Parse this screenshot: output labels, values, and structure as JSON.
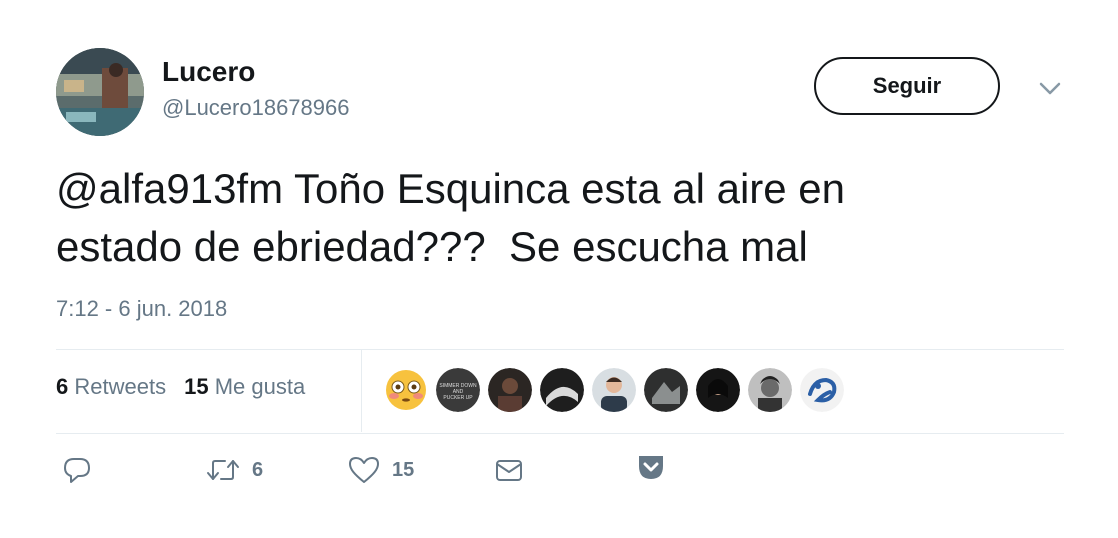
{
  "user": {
    "name": "Lucero",
    "handle": "@Lucero18678966",
    "avatar_icon": "user-avatar-photo"
  },
  "follow_button": {
    "label": "Seguir"
  },
  "menu": {
    "icon": "chevron-down-icon"
  },
  "tweet": {
    "text": "@alfa913fm Toño Esquinca esta al aire en\nestado de ebriedad???  Se escucha mal",
    "timestamp": "7:12 - 6 jun. 2018"
  },
  "stats": {
    "retweets_count": "6",
    "retweets_label": "Retweets",
    "likes_count": "15",
    "likes_label": "Me gusta"
  },
  "likers": [
    {
      "icon": "flushed-emoji-avatar"
    },
    {
      "icon": "liker-avatar-2"
    },
    {
      "icon": "liker-avatar-3"
    },
    {
      "icon": "liker-avatar-4"
    },
    {
      "icon": "liker-avatar-5"
    },
    {
      "icon": "liker-avatar-6"
    },
    {
      "icon": "liker-avatar-7"
    },
    {
      "icon": "liker-avatar-8"
    },
    {
      "icon": "liker-avatar-9"
    }
  ],
  "liker2_text": "SIMMER DOWN AND PUCKER UP",
  "actions": {
    "reply_icon": "reply-icon",
    "retweet_icon": "retweet-icon",
    "retweet_count": "6",
    "like_icon": "heart-icon",
    "like_count": "15",
    "dm_icon": "envelope-icon",
    "pocket_icon": "pocket-icon"
  },
  "colors": {
    "text": "#14171a",
    "secondary": "#657786",
    "divider": "#e6ecf0"
  }
}
